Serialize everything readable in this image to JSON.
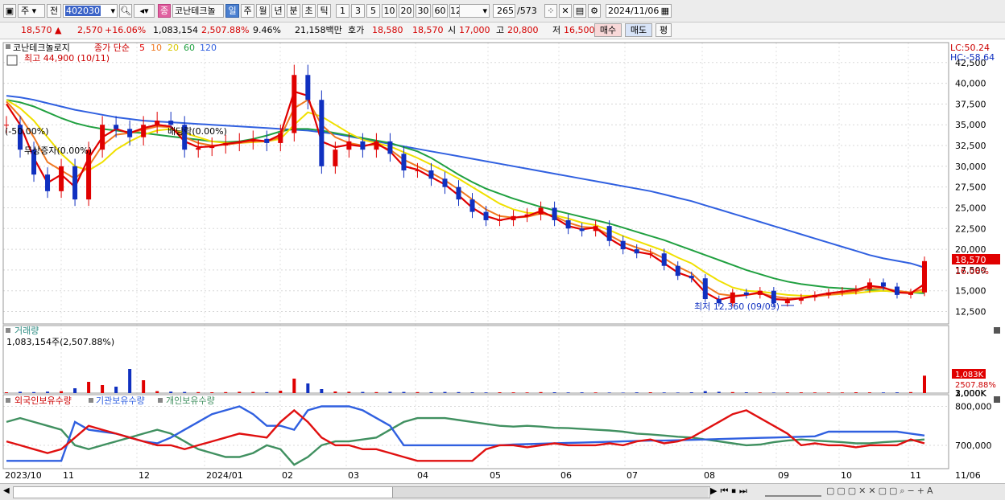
{
  "toolbar": {
    "period_select": "주",
    "mode": "전",
    "code": "402030",
    "company_badge": "종",
    "company": "코난테크놀",
    "periods": [
      "일",
      "주",
      "월",
      "년",
      "분",
      "초",
      "틱"
    ],
    "minutes": [
      "1",
      "3",
      "5",
      "10",
      "20",
      "30",
      "60",
      "120"
    ],
    "count": "265",
    "total": "/573",
    "date": "2024/11/06"
  },
  "quote": {
    "price": "18,570",
    "arrow": "▲",
    "change": "2,570",
    "pct": "+16.06%",
    "volume": "1,083,154",
    "vol_pct": "2,507.88%",
    "turnover": "9.46%",
    "amount": "21,158백만",
    "ask_label": "호가",
    "ask": "18,580",
    "bid": "18,570",
    "open_label": "시",
    "open": "17,000",
    "high_label": "고",
    "high": "20,800",
    "low_label": "저",
    "low": "16,500",
    "buy_label": "매수",
    "sell_label": "매도",
    "avg_label": "평"
  },
  "price_panel": {
    "title": "코난테크놀로지",
    "ma_label": "종가 단순",
    "ma_periods": [
      "5",
      "10",
      "20",
      "60",
      "120"
    ],
    "max_label": "최고 44,900 (10/11)",
    "min_label": "최저 12,360 (09/09)",
    "annot1": "(-50.00%)",
    "annot2": "무상증자(0.00%)",
    "annot3": "배당락(0.00%)",
    "lc": "LC:50.24",
    "hc": "HC:-58.64",
    "price_tag": "18,570",
    "pct_tag": "16.06%",
    "ticks": [
      "42,500",
      "40,000",
      "37,500",
      "35,000",
      "32,500",
      "30,000",
      "27,500",
      "25,000",
      "22,500",
      "20,000",
      "17,500",
      "15,000",
      "12,500"
    ]
  },
  "volume_panel": {
    "title": "거래량",
    "label": "1,083,154주(2,507.88%)",
    "ticks": [
      "3,000K",
      "2,000K",
      "1,000K"
    ],
    "tag": "1,083K",
    "pct_tag": "2507.88%"
  },
  "holders_panel": {
    "legend": [
      "외국인보유수량",
      "기관보유수량",
      "개인보유수량"
    ],
    "ticks": [
      "800,000",
      "700,000"
    ]
  },
  "xaxis": [
    "2023/10",
    "11",
    "12",
    "2024/01",
    "02",
    "03",
    "04",
    "05",
    "06",
    "07",
    "08",
    "09",
    "10",
    "11",
    "11/06"
  ],
  "colors": {
    "up": "#e00000",
    "down": "#1030c0",
    "ma5": "#e00000",
    "ma10": "#f07820",
    "ma20": "#f0e000",
    "ma60": "#20a040",
    "ma120": "#3060e0",
    "foreign": "#e01010",
    "inst": "#3060e0",
    "retail": "#409060"
  },
  "chart_data": {
    "type": "candlestick",
    "ylim": [
      11000,
      44900
    ],
    "close": [
      35000,
      32000,
      29000,
      27000,
      30000,
      26000,
      32000,
      35000,
      34500,
      33500,
      35000,
      35500,
      35000,
      32000,
      32200,
      32500,
      32800,
      33000,
      33300,
      32800,
      34000,
      41000,
      38000,
      30000,
      32000,
      33000,
      32000,
      33000,
      31500,
      29500,
      29500,
      28500,
      27500,
      26000,
      24500,
      23500,
      23500,
      24000,
      24200,
      25000,
      23500,
      22500,
      22200,
      22800,
      21000,
      20000,
      19500,
      19500,
      18000,
      16800,
      16500,
      14000,
      13500,
      14800,
      14500,
      15000,
      13500,
      13800,
      14200,
      14500,
      14800,
      15000,
      15200,
      16000,
      15500,
      14500,
      14800,
      18570
    ],
    "ma5": [
      37500,
      35000,
      31000,
      28000,
      29000,
      27500,
      31000,
      33500,
      34500,
      34000,
      34600,
      35000,
      34800,
      33000,
      32300,
      32400,
      32700,
      32900,
      33200,
      33000,
      33800,
      39000,
      38500,
      33000,
      32300,
      32600,
      32400,
      32800,
      31800,
      30000,
      29600,
      28700,
      27800,
      26500,
      25000,
      24000,
      23500,
      23800,
      24000,
      24600,
      23800,
      22800,
      22400,
      22600,
      21300,
      20300,
      19700,
      19400,
      18300,
      17200,
      16600,
      14800,
      13900,
      14300,
      14500,
      14800,
      14000,
      13900,
      14100,
      14400,
      14700,
      14900,
      15100,
      15600,
      15400,
      14800,
      14700,
      15800
    ],
    "ma10": [
      37800,
      36000,
      33500,
      30500,
      29500,
      28500,
      30000,
      32500,
      33800,
      34000,
      34400,
      34800,
      34700,
      33500,
      32800,
      32500,
      32600,
      32800,
      33000,
      33000,
      33500,
      37000,
      38000,
      35000,
      33500,
      32800,
      32500,
      32600,
      32000,
      30800,
      30000,
      29200,
      28300,
      27200,
      26000,
      24800,
      24000,
      23800,
      23900,
      24300,
      24000,
      23200,
      22700,
      22600,
      21700,
      20800,
      20200,
      19700,
      18900,
      17900,
      17100,
      15600,
      14600,
      14400,
      14500,
      14700,
      14300,
      14100,
      14100,
      14300,
      14500,
      14700,
      14900,
      15300,
      15300,
      15000,
      14800,
      15200
    ],
    "ma20": [
      38000,
      37000,
      35500,
      33500,
      31500,
      30000,
      29500,
      30500,
      32000,
      33000,
      33800,
      34300,
      34500,
      34000,
      33500,
      33000,
      32800,
      32800,
      32900,
      33000,
      33300,
      35000,
      36500,
      36000,
      35000,
      34000,
      33200,
      32800,
      32400,
      31700,
      31000,
      30200,
      29400,
      28500,
      27500,
      26500,
      25500,
      24800,
      24400,
      24300,
      24100,
      23700,
      23200,
      22900,
      22300,
      21600,
      21000,
      20400,
      19800,
      19000,
      18300,
      17200,
      16200,
      15400,
      15000,
      14900,
      14700,
      14500,
      14400,
      14400,
      14500,
      14600,
      14700,
      14900,
      15000,
      14900,
      14800,
      14900
    ],
    "ma60": [
      38000,
      37700,
      37200,
      36500,
      35800,
      35200,
      34800,
      34500,
      34300,
      34100,
      34000,
      33800,
      33600,
      33400,
      33200,
      33000,
      32900,
      33000,
      33300,
      33700,
      34200,
      34500,
      34500,
      34300,
      34000,
      33700,
      33400,
      33100,
      32800,
      32300,
      31800,
      31000,
      30000,
      29000,
      28100,
      27300,
      26700,
      26100,
      25600,
      25100,
      24700,
      24300,
      23900,
      23500,
      23100,
      22600,
      22100,
      21600,
      21100,
      20500,
      19900,
      19300,
      18700,
      18100,
      17500,
      17000,
      16500,
      16100,
      15800,
      15600,
      15400,
      15300,
      15200,
      15100,
      15000,
      14900,
      14800,
      14700
    ],
    "ma120": [
      38500,
      38300,
      38000,
      37600,
      37200,
      36800,
      36500,
      36200,
      35900,
      35700,
      35500,
      35400,
      35300,
      35200,
      35100,
      35000,
      34900,
      34800,
      34700,
      34600,
      34500,
      34400,
      34300,
      34100,
      33900,
      33600,
      33300,
      33000,
      32700,
      32400,
      32100,
      31800,
      31500,
      31200,
      30900,
      30600,
      30300,
      30000,
      29700,
      29400,
      29100,
      28800,
      28500,
      28200,
      27900,
      27600,
      27300,
      27000,
      26600,
      26200,
      25800,
      25300,
      24800,
      24300,
      23800,
      23300,
      22800,
      22300,
      21800,
      21300,
      20800,
      20300,
      19800,
      19300,
      18900,
      18600,
      18300,
      17800
    ],
    "volume_k": [
      50,
      80,
      60,
      90,
      120,
      300,
      700,
      500,
      400,
      1500,
      800,
      120,
      90,
      70,
      60,
      50,
      60,
      80,
      70,
      60,
      150,
      900,
      600,
      250,
      100,
      80,
      70,
      60,
      80,
      70,
      60,
      55,
      70,
      60,
      50,
      40,
      50,
      45,
      40,
      60,
      50,
      40,
      45,
      40,
      35,
      30,
      45,
      50,
      40,
      35,
      50,
      120,
      80,
      60,
      50,
      40,
      35,
      40,
      45,
      40,
      35,
      40,
      50,
      45,
      40,
      45,
      60,
      1083
    ],
    "foreign": [
      710000,
      700000,
      690000,
      680000,
      690000,
      720000,
      750000,
      740000,
      730000,
      720000,
      710000,
      700000,
      700000,
      690000,
      700000,
      710000,
      720000,
      730000,
      725000,
      720000,
      760000,
      790000,
      760000,
      720000,
      700000,
      700000,
      690000,
      690000,
      680000,
      670000,
      660000,
      660000,
      660000,
      660000,
      660000,
      690000,
      700000,
      700000,
      695000,
      700000,
      705000,
      700000,
      700000,
      700000,
      705000,
      700000,
      710000,
      715000,
      705000,
      710000,
      720000,
      740000,
      760000,
      780000,
      790000,
      770000,
      750000,
      730000,
      700000,
      705000,
      700000,
      700000,
      695000,
      700000,
      700000,
      700000,
      715000,
      705000
    ],
    "institution": [
      660000,
      660000,
      660000,
      660000,
      660000,
      760000,
      740000,
      735000,
      730000,
      720000,
      710000,
      705000,
      720000,
      740000,
      760000,
      780000,
      790000,
      800000,
      780000,
      750000,
      750000,
      740000,
      790000,
      800000,
      800000,
      800000,
      790000,
      770000,
      750000,
      700000,
      700000,
      700000,
      700000,
      700000,
      700000,
      700000,
      700000,
      702000,
      703000,
      704000,
      705000,
      706000,
      707000,
      708000,
      709000,
      710000,
      711000,
      712000,
      712000,
      713000,
      714000,
      715000,
      716000,
      717000,
      718000,
      719000,
      720000,
      721000,
      722000,
      723000,
      735000,
      735000,
      735000,
      735000,
      735000,
      735000,
      730000,
      725000
    ],
    "retail": [
      760000,
      770000,
      760000,
      750000,
      740000,
      700000,
      690000,
      700000,
      710000,
      720000,
      730000,
      740000,
      730000,
      710000,
      690000,
      680000,
      670000,
      670000,
      680000,
      700000,
      690000,
      650000,
      670000,
      700000,
      710000,
      710000,
      715000,
      720000,
      740000,
      760000,
      770000,
      770000,
      770000,
      765000,
      760000,
      755000,
      750000,
      748000,
      750000,
      748000,
      745000,
      744000,
      742000,
      740000,
      738000,
      735000,
      730000,
      728000,
      725000,
      722000,
      720000,
      715000,
      710000,
      705000,
      700000,
      702000,
      708000,
      712000,
      715000,
      712000,
      710000,
      708000,
      705000,
      705000,
      708000,
      710000,
      712000,
      715000
    ]
  }
}
